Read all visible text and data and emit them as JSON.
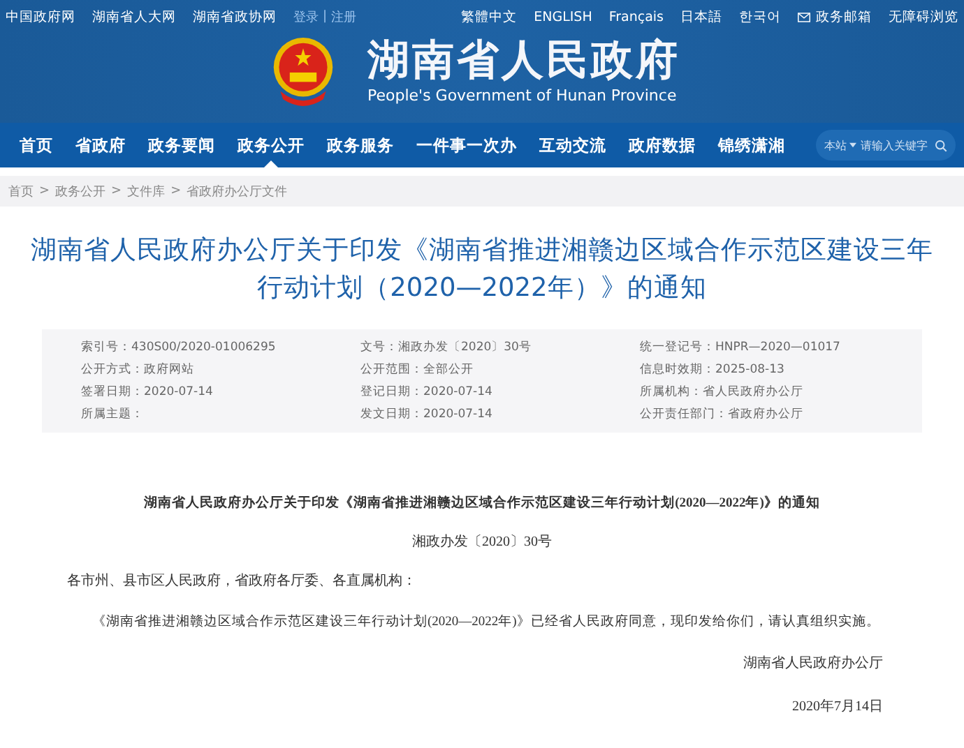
{
  "top_links": {
    "left": [
      "中国政府网",
      "湖南省人大网",
      "湖南省政协网"
    ],
    "account": [
      "登录",
      "注册"
    ],
    "account_separator": "|",
    "right": [
      {
        "label": "繁體中文",
        "kind": "text"
      },
      {
        "label": "ENGLISH",
        "kind": "text"
      },
      {
        "label": "Français",
        "kind": "text"
      },
      {
        "label": "日本語",
        "kind": "text"
      },
      {
        "label": "한국어",
        "kind": "text"
      },
      {
        "label": "政务邮箱",
        "kind": "mail"
      },
      {
        "label": "无障碍浏览",
        "kind": "text"
      }
    ]
  },
  "site": {
    "title": "湖南省人民政府",
    "subtitle": "People's Government of Hunan Province"
  },
  "nav": [
    {
      "label": "首页",
      "selected": false
    },
    {
      "label": "省政府",
      "selected": false
    },
    {
      "label": "政务要闻",
      "selected": false
    },
    {
      "label": "政务公开",
      "selected": true
    },
    {
      "label": "政务服务",
      "selected": false
    },
    {
      "label": "一件事一次办",
      "selected": false
    },
    {
      "label": "互动交流",
      "selected": false
    },
    {
      "label": "政府数据",
      "selected": false
    },
    {
      "label": "锦绣潇湘",
      "selected": false
    }
  ],
  "search": {
    "scope": "本站",
    "placeholder": "请输入关键字"
  },
  "breadcrumb": [
    "首页",
    "政务公开",
    "文件库",
    "省政府办公厅文件"
  ],
  "breadcrumb_separator": ">",
  "article_title": "湖南省人民政府办公厅关于印发《湖南省推进湘赣边区域合作示范区建设三年行动计划（2020—2022年）》的通知",
  "meta": [
    {
      "label": "索引号：",
      "value": "430S00/2020-01006295"
    },
    {
      "label": "文号：",
      "value": "湘政办发〔2020〕30号"
    },
    {
      "label": "统一登记号：",
      "value": "HNPR—2020—01017"
    },
    {
      "label": "公开方式：",
      "value": "政府网站"
    },
    {
      "label": "公开范围：",
      "value": "全部公开"
    },
    {
      "label": "信息时效期：",
      "value": "2025-08-13"
    },
    {
      "label": "签署日期：",
      "value": "2020-07-14"
    },
    {
      "label": "登记日期：",
      "value": "2020-07-14"
    },
    {
      "label": "所属机构：",
      "value": "省人民政府办公厅"
    },
    {
      "label": "所属主题："
    },
    {
      "label": "发文日期：",
      "value": "2020-07-14"
    },
    {
      "label": "公开责任部门：",
      "value": "省政府办公厅"
    }
  ],
  "document": {
    "title": "湖南省人民政府办公厅关于印发《湖南省推进湘赣边区域合作示范区建设三年行动计划(2020—2022年)》的通知",
    "number": "湘政办发〔2020〕30号",
    "salutation": "各市州、县市区人民政府，省政府各厅委、各直属机构：",
    "paragraph": "《湖南省推进湘赣边区域合作示范区建设三年行动计划(2020—2022年)》已经省人民政府同意，现印发给你们，请认真组织实施。",
    "signature": "湖南省人民政府办公厅",
    "date": "2020年7月14日"
  }
}
